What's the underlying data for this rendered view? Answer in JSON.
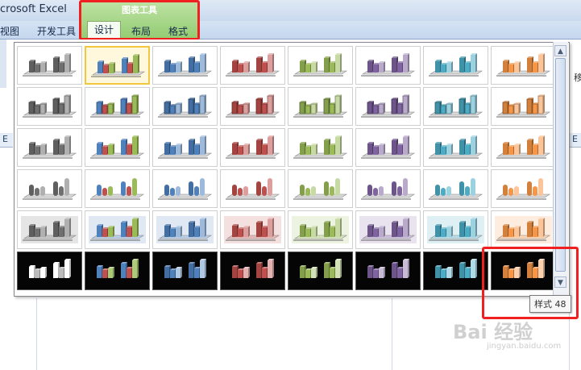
{
  "app": {
    "title": "crosoft Excel"
  },
  "tabs": [
    {
      "label": "视图"
    },
    {
      "label": "开发工具"
    }
  ],
  "chart_tools": {
    "title": "图表工具",
    "tabs": [
      {
        "label": "设计",
        "active": true
      },
      {
        "label": "布局"
      },
      {
        "label": "格式"
      }
    ]
  },
  "sheet": {
    "col_left": "E",
    "col_right": "E",
    "side_label": "移"
  },
  "gallery": {
    "rows": 6,
    "cols": 8,
    "selected_index": 1,
    "highlighted_index": 47,
    "style_variants": [
      "flat",
      "outlined",
      "bevel",
      "cylinder",
      "shaded",
      "dark"
    ],
    "colors": [
      "#707070",
      "#4f81bd",
      "#4f81bd",
      "#c0504d",
      "#9bbb59",
      "#8064a2",
      "#4bacc6",
      "#f79646"
    ],
    "multicolor_column": 1
  },
  "tooltip": {
    "text": "样式 48"
  },
  "scrollbar": {
    "up": "▲",
    "down": "▼"
  },
  "watermark": {
    "text": "Bai 经验",
    "url": "jingyan.baidu.com"
  },
  "colors": {
    "highlight": "#f02020",
    "selected": "#f2c73e",
    "context_tab": "#93cc72"
  }
}
